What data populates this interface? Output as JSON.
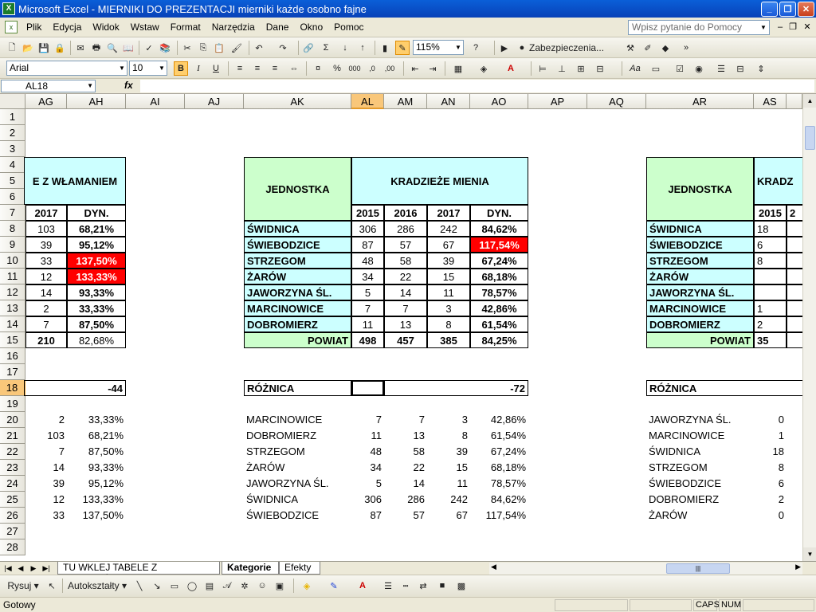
{
  "window": {
    "title": "Microsoft Excel - MIERNIKI DO PREZENTACJI mierniki każde osobno fajne"
  },
  "menu": {
    "items": [
      "Plik",
      "Edycja",
      "Widok",
      "Wstaw",
      "Format",
      "Narzędzia",
      "Dane",
      "Okno",
      "Pomoc"
    ],
    "help_placeholder": "Wpisz pytanie do Pomocy"
  },
  "toolbar": {
    "zoom": "115%",
    "security_label": "Zabezpieczenia..."
  },
  "format_toolbar": {
    "font": "Arial",
    "size": "10",
    "bold": "B",
    "italic": "I",
    "underline": "U"
  },
  "formula_bar": {
    "cell_ref": "AL18",
    "fx": "fx",
    "content": ""
  },
  "columns": [
    "AG",
    "AH",
    "AI",
    "AJ",
    "AK",
    "AL",
    "AM",
    "AN",
    "AO",
    "AP",
    "AQ",
    "AR",
    "AS"
  ],
  "active_column": "AL",
  "active_row": 18,
  "rows": [
    1,
    2,
    3,
    4,
    5,
    6,
    7,
    8,
    9,
    10,
    11,
    12,
    13,
    14,
    15,
    16,
    17,
    18,
    19,
    20,
    21,
    22,
    23,
    24,
    25,
    26,
    27,
    28
  ],
  "table1": {
    "header_title": "E Z WŁAMANIEM",
    "col_2017": "2017",
    "col_dyn": "DYN.",
    "rows": [
      {
        "v2017": "103",
        "dyn": "68,21%"
      },
      {
        "v2017": "39",
        "dyn": "95,12%"
      },
      {
        "v2017": "33",
        "dyn": "137,50%"
      },
      {
        "v2017": "12",
        "dyn": "133,33%"
      },
      {
        "v2017": "14",
        "dyn": "93,33%"
      },
      {
        "v2017": "2",
        "dyn": "33,33%"
      },
      {
        "v2017": "7",
        "dyn": "87,50%"
      },
      {
        "v2017": "210",
        "dyn": "82,68%"
      }
    ],
    "roznica": "-44",
    "sorted": [
      {
        "v2017": "2",
        "dyn": "33,33%"
      },
      {
        "v2017": "103",
        "dyn": "68,21%"
      },
      {
        "v2017": "7",
        "dyn": "87,50%"
      },
      {
        "v2017": "14",
        "dyn": "93,33%"
      },
      {
        "v2017": "39",
        "dyn": "95,12%"
      },
      {
        "v2017": "12",
        "dyn": "133,33%"
      },
      {
        "v2017": "33",
        "dyn": "137,50%"
      }
    ]
  },
  "table2": {
    "jednostka": "JEDNOSTKA",
    "title": "KRADZIEŻE MIENIA",
    "years": [
      "2015",
      "2016",
      "2017"
    ],
    "dyn": "DYN.",
    "rows": [
      {
        "name": "ŚWIDNICA",
        "v2015": "306",
        "v2016": "286",
        "v2017": "242",
        "dyn": "84,62%"
      },
      {
        "name": "ŚWIEBODZICE",
        "v2015": "87",
        "v2016": "57",
        "v2017": "67",
        "dyn": "117,54%"
      },
      {
        "name": "STRZEGOM",
        "v2015": "48",
        "v2016": "58",
        "v2017": "39",
        "dyn": "67,24%"
      },
      {
        "name": "ŻARÓW",
        "v2015": "34",
        "v2016": "22",
        "v2017": "15",
        "dyn": "68,18%"
      },
      {
        "name": "JAWORZYNA ŚL.",
        "v2015": "5",
        "v2016": "14",
        "v2017": "11",
        "dyn": "78,57%"
      },
      {
        "name": "MARCINOWICE",
        "v2015": "7",
        "v2016": "7",
        "v2017": "3",
        "dyn": "42,86%"
      },
      {
        "name": "DOBROMIERZ",
        "v2015": "11",
        "v2016": "13",
        "v2017": "8",
        "dyn": "61,54%"
      }
    ],
    "powiat": {
      "name": "POWIAT",
      "v2015": "498",
      "v2016": "457",
      "v2017": "385",
      "dyn": "84,25%"
    },
    "roznica_label": "RÓŻNICA",
    "roznica": "-72",
    "sorted": [
      {
        "name": "MARCINOWICE",
        "v2015": "7",
        "v2016": "7",
        "v2017": "3",
        "dyn": "42,86%"
      },
      {
        "name": "DOBROMIERZ",
        "v2015": "11",
        "v2016": "13",
        "v2017": "8",
        "dyn": "61,54%"
      },
      {
        "name": "STRZEGOM",
        "v2015": "48",
        "v2016": "58",
        "v2017": "39",
        "dyn": "67,24%"
      },
      {
        "name": "ŻARÓW",
        "v2015": "34",
        "v2016": "22",
        "v2017": "15",
        "dyn": "68,18%"
      },
      {
        "name": "JAWORZYNA ŚL.",
        "v2015": "5",
        "v2016": "14",
        "v2017": "11",
        "dyn": "78,57%"
      },
      {
        "name": "ŚWIDNICA",
        "v2015": "306",
        "v2016": "286",
        "v2017": "242",
        "dyn": "84,62%"
      },
      {
        "name": "ŚWIEBODZICE",
        "v2015": "87",
        "v2016": "57",
        "v2017": "67",
        "dyn": "117,54%"
      }
    ]
  },
  "table3": {
    "jednostka": "JEDNOSTKA",
    "title": "KRADZ",
    "year": "2015",
    "year2": "2",
    "rows": [
      {
        "name": "ŚWIDNICA",
        "v2015": "18"
      },
      {
        "name": "ŚWIEBODZICE",
        "v2015": "6"
      },
      {
        "name": "STRZEGOM",
        "v2015": "8"
      },
      {
        "name": "ŻARÓW",
        "v2015": ""
      },
      {
        "name": "JAWORZYNA ŚL.",
        "v2015": ""
      },
      {
        "name": "MARCINOWICE",
        "v2015": "1"
      },
      {
        "name": "DOBROMIERZ",
        "v2015": "2"
      }
    ],
    "powiat": {
      "name": "POWIAT",
      "v2015": "35"
    },
    "roznica_label": "RÓŻNICA",
    "sorted": [
      {
        "name": "JAWORZYNA ŚL.",
        "v2015": "0"
      },
      {
        "name": "MARCINOWICE",
        "v2015": "1"
      },
      {
        "name": "ŚWIDNICA",
        "v2015": "18"
      },
      {
        "name": "STRZEGOM",
        "v2015": "8"
      },
      {
        "name": "ŚWIEBODZICE",
        "v2015": "6"
      },
      {
        "name": "DOBROMIERZ",
        "v2015": "2"
      },
      {
        "name": "ŻARÓW",
        "v2015": "0"
      }
    ]
  },
  "sheet_tabs": [
    "TU WKLEJ TABELE Z MIERNIKÓW",
    "Kategorie",
    "Efekty"
  ],
  "active_tab": "Kategorie",
  "drawing": {
    "draw_label": "Rysuj",
    "autoshapes_label": "Autokształty"
  },
  "status": {
    "text": "Gotowy",
    "caps": "CAPS",
    "num": "NUM"
  }
}
